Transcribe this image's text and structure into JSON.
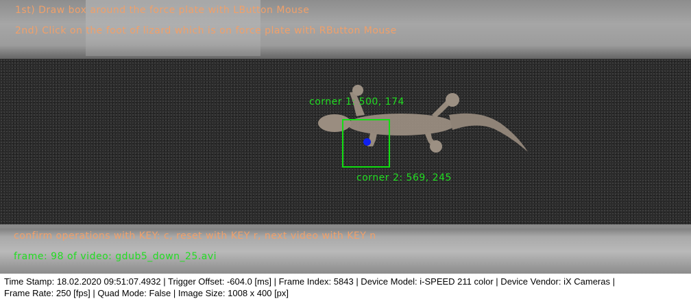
{
  "overlay": {
    "instruction_1": "1st) Draw box around the force plate with LButton Mouse",
    "instruction_2": "2nd) Click on the foot of lizard which is on force plate with RButton Mouse",
    "corner_1_label": "corner 1: 500, 174",
    "corner_2_label": "corner 2: 569, 245",
    "confirm_hint": "confirm operations with KEY: c, reset with KEY r, next video with KEY n",
    "frame_info": "frame: 98 of video: gdub5_down_25.avi"
  },
  "status": {
    "line1": "Time Stamp: 18.02.2020 09:51:07.4932  |  Trigger Offset: -604.0 [ms]  |  Frame Index: 5843  |  Device Model: i-SPEED 211 color  |  Device Vendor: iX Cameras  |",
    "line2": "Frame Rate: 250 [fps]  |  Quad Mode: False  |  Image Size: 1008 x 400 [px]"
  },
  "colors": {
    "instruction_text": "#f0a06a",
    "corner_text": "#22dd22",
    "roi_box": "#11e011",
    "foot_marker": "#1020f0"
  }
}
